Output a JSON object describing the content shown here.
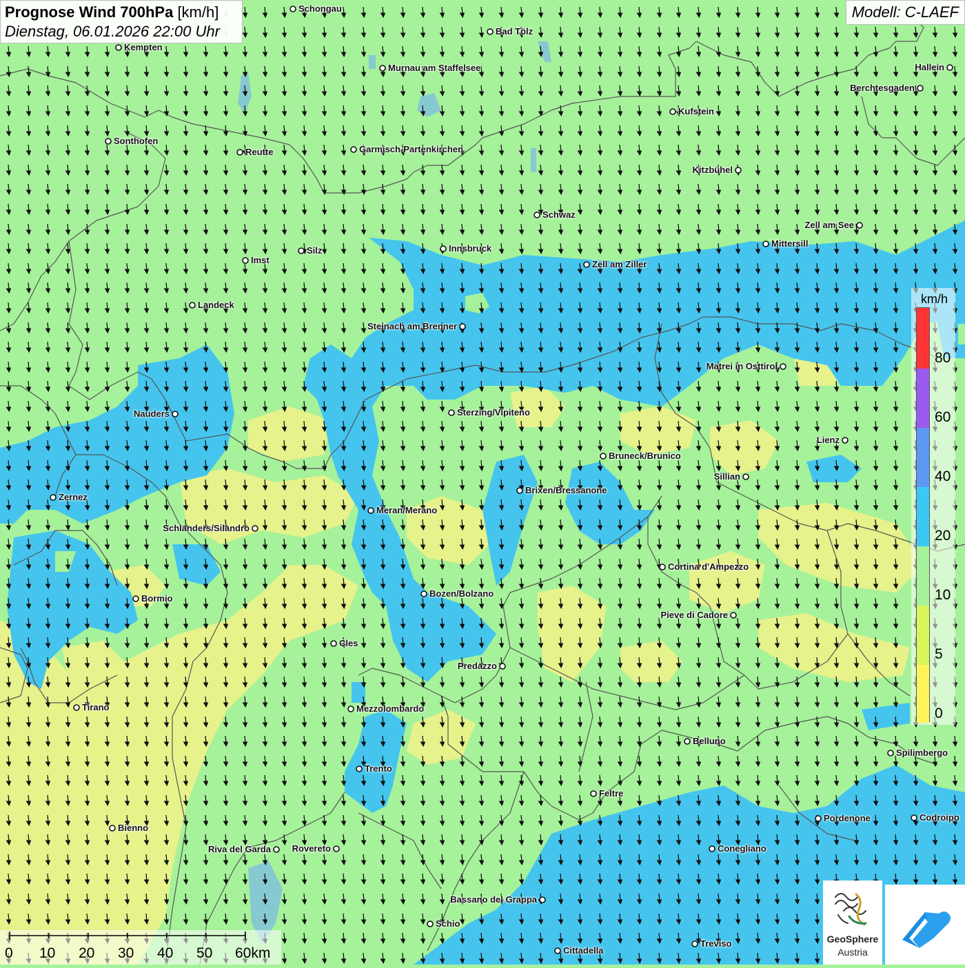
{
  "title": {
    "main": "Prognose Wind 700hPa",
    "unit": "[km/h]",
    "datetime": "Dienstag, 06.01.2026 22:00 Uhr"
  },
  "model_label": "Modell: C-LAEF",
  "legend": {
    "unit": "km/h",
    "ticks": [
      "80",
      "60",
      "40",
      "20",
      "10",
      "5",
      "0"
    ],
    "colors": [
      "#ff3434",
      "#9a5af0",
      "#5c98f2",
      "#3cc8f5",
      "#a6f29a",
      "#d8f55a",
      "#fff45a"
    ]
  },
  "scalebar": {
    "labels": [
      "0",
      "10",
      "20",
      "30",
      "40",
      "50",
      "60km"
    ]
  },
  "logo": {
    "line1": "GeoSphere",
    "line2": "Austria"
  },
  "cities": [
    "Schongau",
    "Bad Tölz",
    "Kempten",
    "Murnau am Staffelsee",
    "Hallein",
    "Berchtesgaden",
    "Kufstein",
    "Sonthofen",
    "Reutte",
    "Garmisch-Partenkirchen",
    "Kitzbühel",
    "Schwaz",
    "Zell am See",
    "Innsbruck",
    "Mittersill",
    "Silz",
    "Imst",
    "Zell am Ziller",
    "Landeck",
    "Steinach am Brenner",
    "Matrei in Osttirol",
    "Nauders",
    "Sterzing/Vipiteno",
    "Lienz",
    "Bruneck/Brunico",
    "Sillian",
    "Zernez",
    "Brixen/Bressanone",
    "Meran/Merano",
    "Schlanders/Silandro",
    "Cortina d'Ampezzo",
    "Bozen/Bolzano",
    "Bormio",
    "Pieve di Cadore",
    "Cles",
    "Predazzo",
    "Tirano",
    "Mezzolombardo",
    "Belluno",
    "Spilimbergo",
    "Trento",
    "Feltre",
    "Pordenone",
    "Codroipo",
    "Bienno",
    "Riva del Garda",
    "Rovereto",
    "Conegliano",
    "Bassano del Grappa",
    "Schio",
    "Treviso",
    "Cittadella"
  ],
  "colors": {
    "green": "#a6f29a",
    "blue": "#3cc8f5",
    "yellow": "#f4f285",
    "border": "#555555",
    "arrow": "#111111"
  },
  "wind_direction": "north-to-south (arrows pointing down)"
}
